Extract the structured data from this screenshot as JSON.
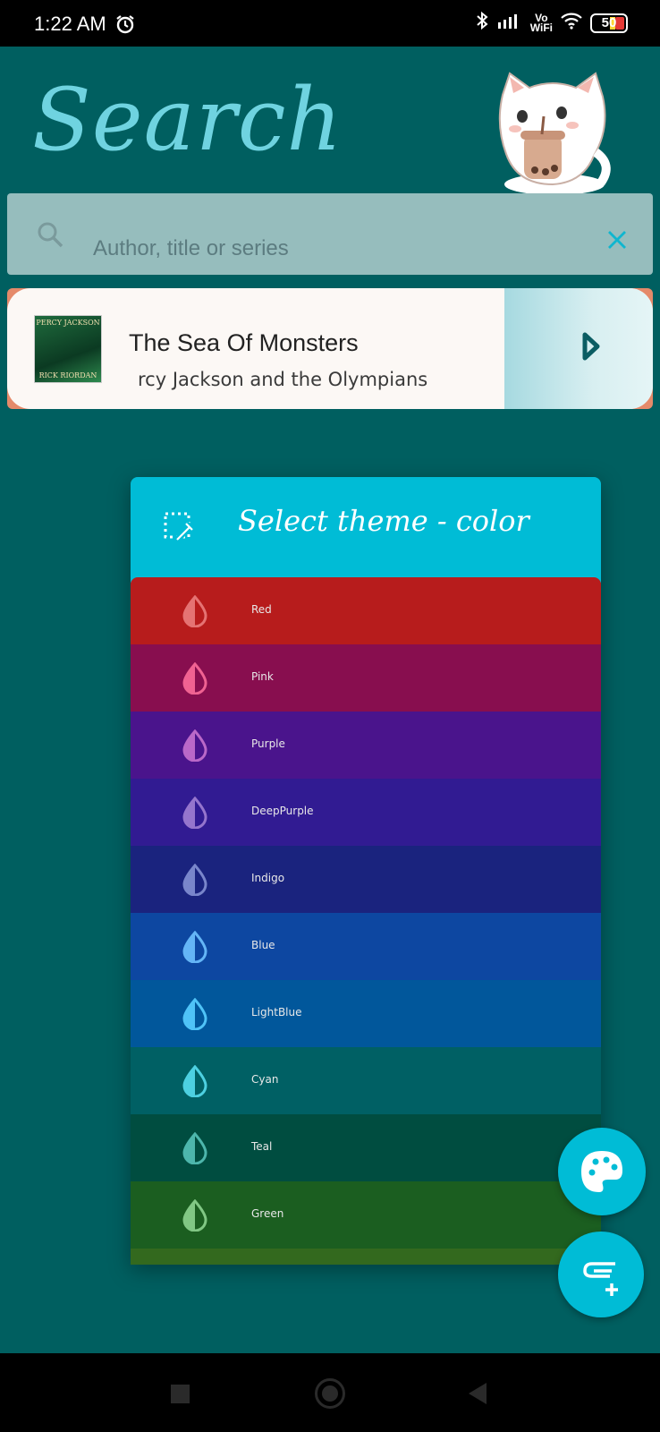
{
  "status_bar": {
    "time": "1:22 AM",
    "network_label_top": "Vo",
    "network_label_bottom": "WiFi",
    "battery": "50"
  },
  "header": {
    "title": "Search"
  },
  "search": {
    "placeholder": "Author, title or series",
    "value": ""
  },
  "result": {
    "title": "The Sea Of Monsters",
    "series": "rcy Jackson and the Olympians",
    "cover_top_text": "PERCY JACKSON",
    "cover_bottom_text": "RICK RIORDAN"
  },
  "theme_dialog": {
    "title": "Select theme - color",
    "colors": [
      {
        "name": "Red",
        "bg": "#b71c1c",
        "drop": "#e57373"
      },
      {
        "name": "Pink",
        "bg": "#880e4f",
        "drop": "#f06292"
      },
      {
        "name": "Purple",
        "bg": "#4a148c",
        "drop": "#ba68c8"
      },
      {
        "name": "DeepPurple",
        "bg": "#311b92",
        "drop": "#9575cd"
      },
      {
        "name": "Indigo",
        "bg": "#1a237e",
        "drop": "#7986cb"
      },
      {
        "name": "Blue",
        "bg": "#0d47a1",
        "drop": "#64b5f6"
      },
      {
        "name": "LightBlue",
        "bg": "#01579b",
        "drop": "#4fc3f7"
      },
      {
        "name": "Cyan",
        "bg": "#006064",
        "drop": "#4dd0e1"
      },
      {
        "name": "Teal",
        "bg": "#004d40",
        "drop": "#4db6ac"
      },
      {
        "name": "Green",
        "bg": "#1b5e20",
        "drop": "#81c784"
      }
    ]
  },
  "colors": {
    "background": "#005f60",
    "accent": "#00bcd6",
    "title": "#6fd3e0"
  }
}
